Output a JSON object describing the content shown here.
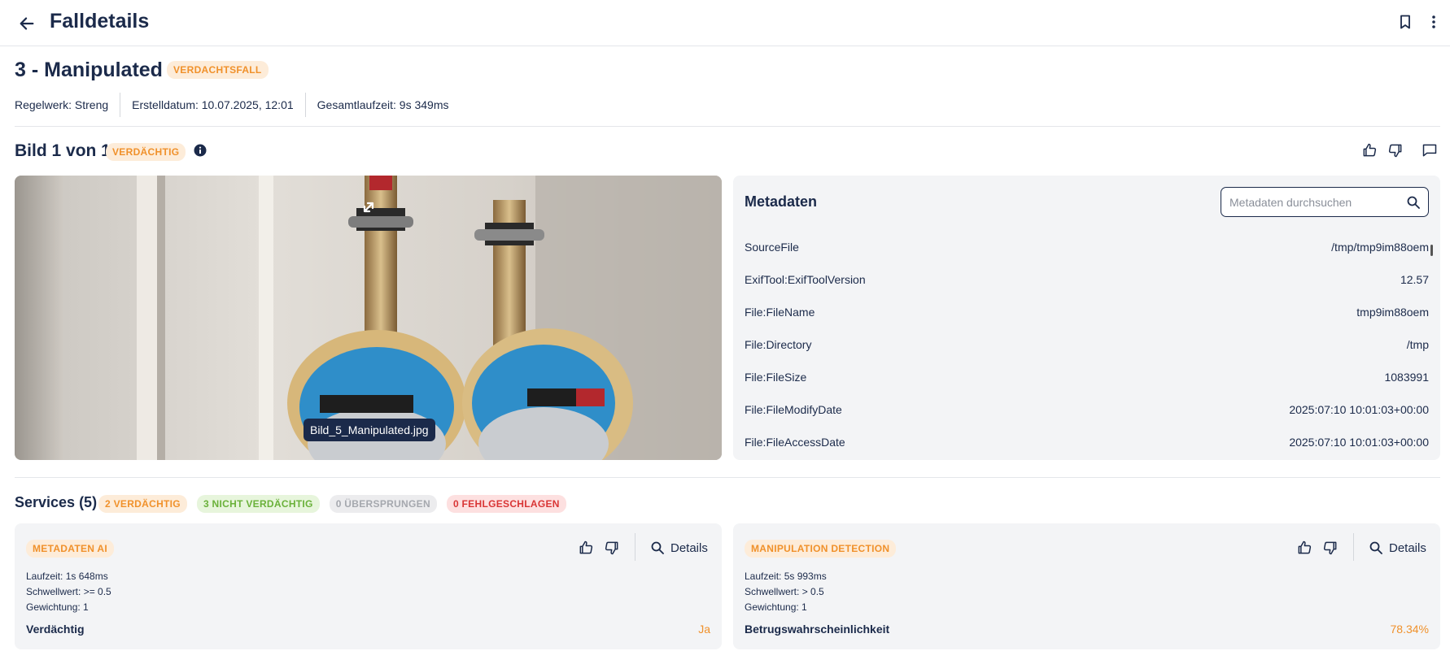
{
  "header": {
    "title": "Falldetails"
  },
  "case": {
    "title": "3 - Manipulated",
    "badge": "VERDACHTSFALL",
    "meta": [
      "Regelwerk: Streng",
      "Erstelldatum: 10.07.2025, 12:01",
      "Gesamtlaufzeit: 9s 349ms"
    ]
  },
  "image_section": {
    "title": "Bild 1 von 1",
    "badge": "VERDÄCHTIG",
    "filename": "Bild_5_Manipulated.jpg"
  },
  "metadata_panel": {
    "title": "Metadaten",
    "search_placeholder": "Metadaten durchsuchen",
    "rows": [
      {
        "key": "SourceFile",
        "value": "/tmp/tmp9im88oem"
      },
      {
        "key": "ExifTool:ExifToolVersion",
        "value": "12.57"
      },
      {
        "key": "File:FileName",
        "value": "tmp9im88oem"
      },
      {
        "key": "File:Directory",
        "value": "/tmp"
      },
      {
        "key": "File:FileSize",
        "value": "1083991"
      },
      {
        "key": "File:FileModifyDate",
        "value": "2025:07:10 10:01:03+00:00"
      },
      {
        "key": "File:FileAccessDate",
        "value": "2025:07:10 10:01:03+00:00"
      }
    ]
  },
  "services": {
    "title": "Services (5)",
    "badges": [
      {
        "label": "2 VERDÄCHTIG",
        "tone": "orange"
      },
      {
        "label": "3 NICHT VERDÄCHTIG",
        "tone": "green"
      },
      {
        "label": "0 ÜBERSPRUNGEN",
        "tone": "gray"
      },
      {
        "label": "0 FEHLGESCHLAGEN",
        "tone": "red"
      }
    ],
    "cards": [
      {
        "name": "METADATEN AI",
        "details_label": "Details",
        "runtime": "Laufzeit: 1s 648ms",
        "threshold": "Schwellwert: >= 0.5",
        "weight": "Gewichtung: 1",
        "result_label": "Verdächtig",
        "result_value": "Ja"
      },
      {
        "name": "MANIPULATION DETECTION",
        "details_label": "Details",
        "runtime": "Laufzeit: 5s 993ms",
        "threshold": "Schwellwert: > 0.5",
        "weight": "Gewichtung: 1",
        "result_label": "Betrugswahrscheinlichkeit",
        "result_value": "78.34%"
      }
    ]
  },
  "colors": {
    "navy": "#1b2a4a",
    "suspicious_orange": "#f0912b",
    "ok_green": "#6ab13a",
    "fail_red": "#d93535",
    "panel_bg": "#f3f4f6"
  },
  "icons": [
    "back-arrow-icon",
    "bookmark-icon",
    "more-vertical-icon",
    "info-icon",
    "thumbs-up-icon",
    "thumbs-down-icon",
    "comment-icon",
    "expand-icon",
    "search-icon"
  ]
}
